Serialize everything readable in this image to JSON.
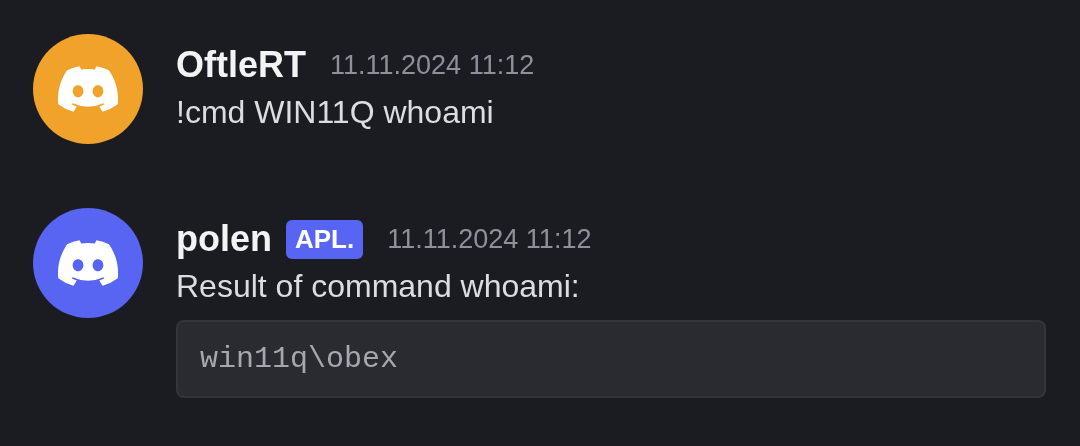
{
  "messages": [
    {
      "author": "OftleRT",
      "color": "#f0a22a",
      "timestamp": "11.11.2024 11:12",
      "text": "!cmd WIN11Q whoami"
    },
    {
      "author": "polen",
      "color": "#5865f2",
      "badge": "APL.",
      "timestamp": "11.11.2024 11:12",
      "text": "Result of command whoami:",
      "code": "win11q\\obex"
    }
  ]
}
